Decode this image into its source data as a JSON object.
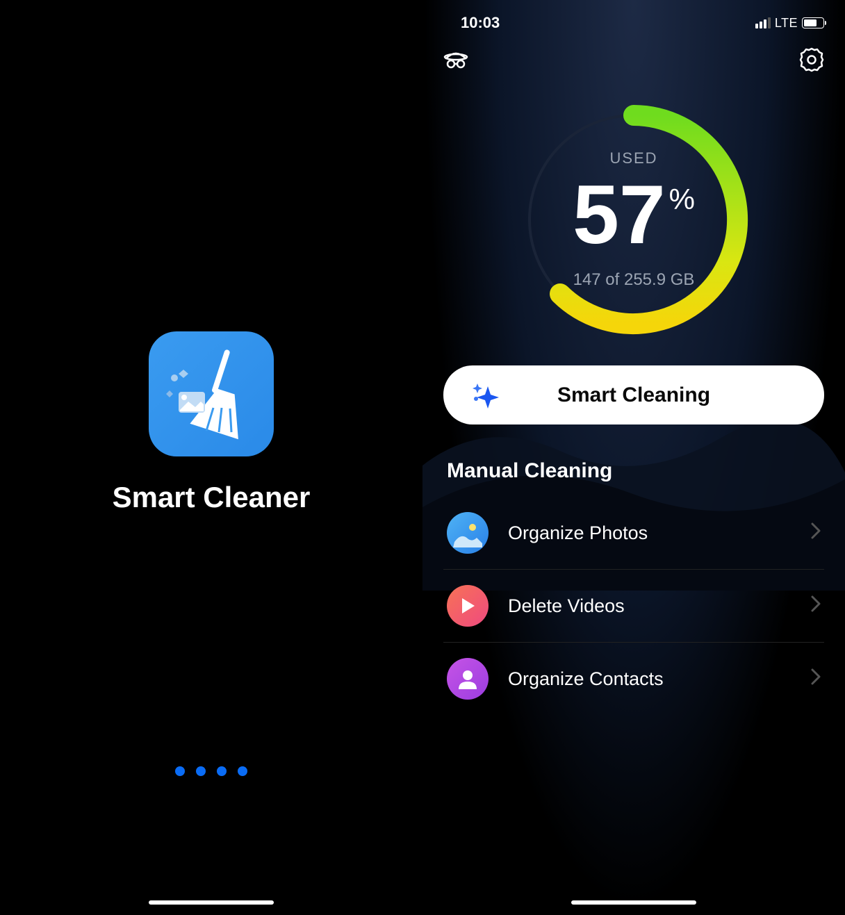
{
  "splash": {
    "app_name": "Smart Cleaner",
    "icon_name": "broom-cleaner-icon"
  },
  "status_bar": {
    "time": "10:03",
    "network": "LTE",
    "battery_percent": 70,
    "signal_bars": 3
  },
  "dashboard": {
    "used_label": "USED",
    "percent": "57",
    "percent_sign": "%",
    "storage_text": "147 of 255.9 GB",
    "ring_colors": {
      "start": "#6fdc1e",
      "end": "#f5e60a"
    },
    "smart_button": "Smart Cleaning",
    "manual_title": "Manual Cleaning",
    "items": [
      {
        "label": "Organize Photos",
        "icon": "photos-icon"
      },
      {
        "label": "Delete Videos",
        "icon": "videos-icon"
      },
      {
        "label": "Organize Contacts",
        "icon": "contacts-icon"
      }
    ]
  }
}
